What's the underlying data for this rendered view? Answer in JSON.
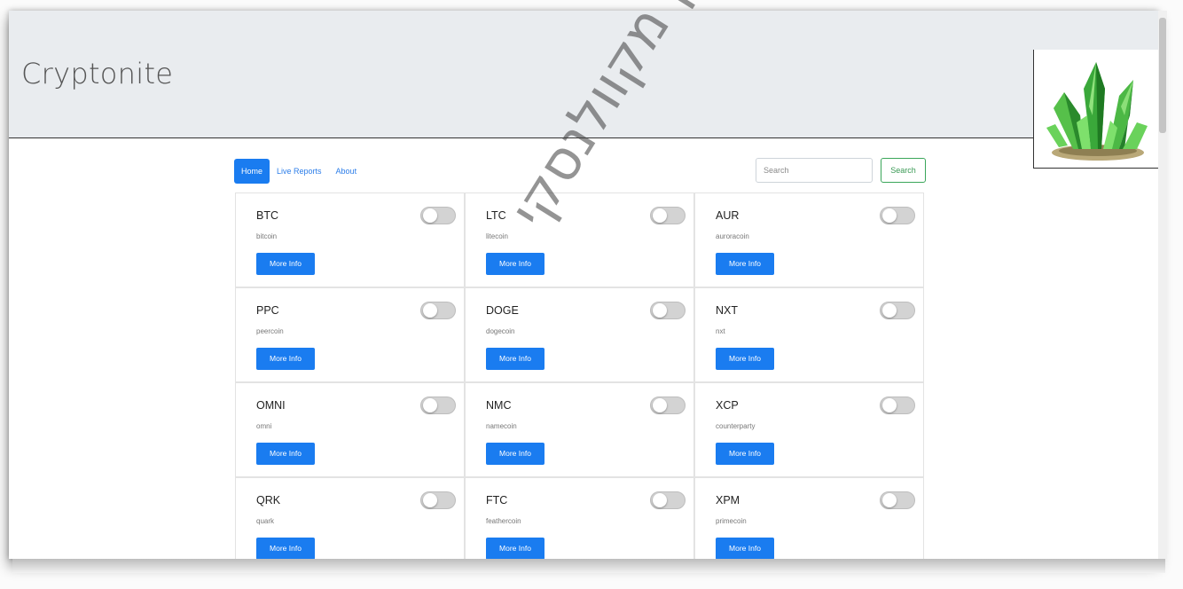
{
  "header": {
    "brand": "Cryptonite"
  },
  "logo": {
    "alt_icon": "green-crystal-logo",
    "accent": "#3cb43c"
  },
  "nav": {
    "items": [
      {
        "label": "Home",
        "active": true
      },
      {
        "label": "Live Reports",
        "active": false
      },
      {
        "label": "About",
        "active": false
      }
    ]
  },
  "search": {
    "placeholder": "Search",
    "button_label": "Search"
  },
  "cards": [
    {
      "symbol": "BTC",
      "name": "bitcoin",
      "button": "More Info",
      "toggled": false
    },
    {
      "symbol": "LTC",
      "name": "litecoin",
      "button": "More Info",
      "toggled": false
    },
    {
      "symbol": "AUR",
      "name": "auroracoin",
      "button": "More Info",
      "toggled": false
    },
    {
      "symbol": "PPC",
      "name": "peercoin",
      "button": "More Info",
      "toggled": false
    },
    {
      "symbol": "DOGE",
      "name": "dogecoin",
      "button": "More Info",
      "toggled": false
    },
    {
      "symbol": "NXT",
      "name": "nxt",
      "button": "More Info",
      "toggled": false
    },
    {
      "symbol": "OMNI",
      "name": "omni",
      "button": "More Info",
      "toggled": false
    },
    {
      "symbol": "NMC",
      "name": "namecoin",
      "button": "More Info",
      "toggled": false
    },
    {
      "symbol": "XCP",
      "name": "counterparty",
      "button": "More Info",
      "toggled": false
    },
    {
      "symbol": "QRK",
      "name": "quark",
      "button": "More Info",
      "toggled": false
    },
    {
      "symbol": "FTC",
      "name": "feathercoin",
      "button": "More Info",
      "toggled": false
    },
    {
      "symbol": "XPM",
      "name": "primecoin",
      "button": "More Info",
      "toggled": false
    }
  ],
  "watermark": {
    "text": "על ידי יונתן מקוולנסקי"
  },
  "colors": {
    "primary": "#1a7cf0",
    "success": "#3aa65a",
    "header_bg": "#e9ecef"
  }
}
